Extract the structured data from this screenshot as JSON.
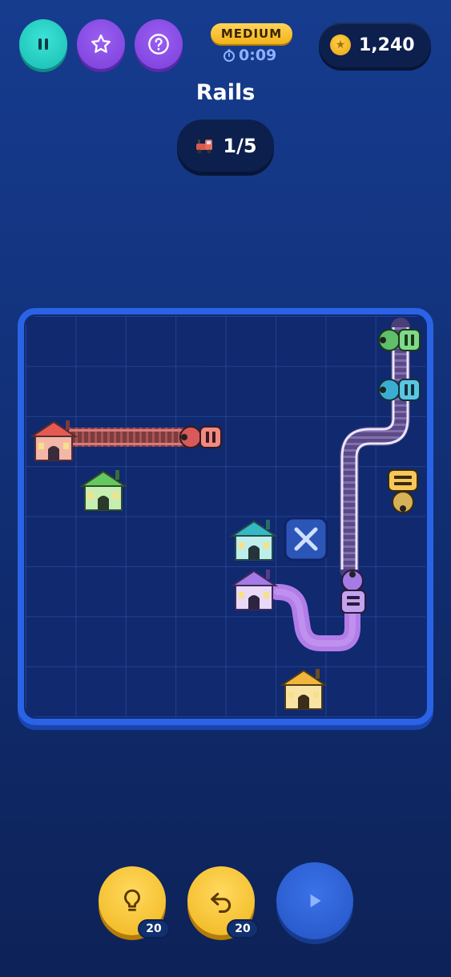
{
  "header": {
    "difficulty": "MEDIUM",
    "timer": "0:09",
    "coins": "1,240",
    "title": "Rails",
    "level_progress": "1/5"
  },
  "controls": {
    "pause_icon": "pause-icon",
    "star_icon": "star-icon",
    "help_icon": "help-icon"
  },
  "board": {
    "rows": 8,
    "cols": 8,
    "stations": [
      {
        "color": "#e46a6a",
        "name": "red-station"
      },
      {
        "color": "#5fc86c",
        "name": "green-station"
      },
      {
        "color": "#38b9c9",
        "name": "teal-station"
      },
      {
        "color": "#a57be6",
        "name": "purple-station"
      },
      {
        "color": "#f2b53a",
        "name": "yellow-station"
      }
    ],
    "trains": [
      "red",
      "green",
      "teal",
      "yellow",
      "purple"
    ]
  },
  "footer": {
    "hint_count": "20",
    "undo_count": "20"
  },
  "colors": {
    "accent": "#2a63e6",
    "teal": "#19bdb2",
    "purple": "#7b3fdc",
    "gold": "#f0b51c"
  }
}
